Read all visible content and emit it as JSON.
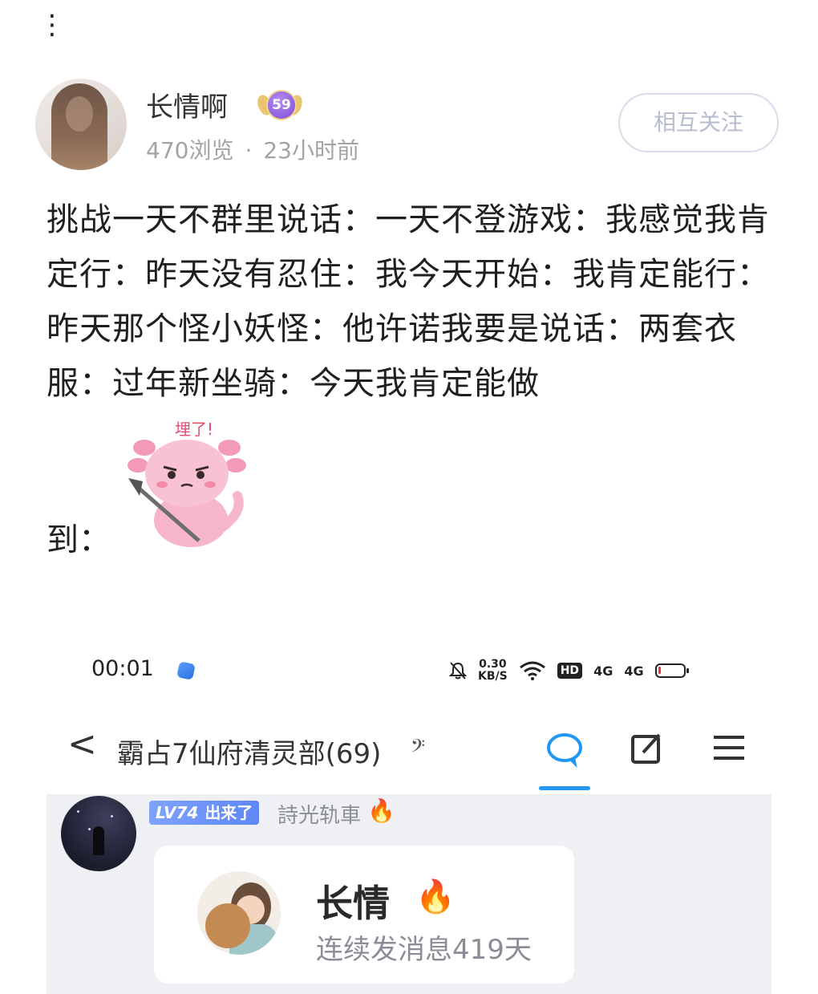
{
  "post": {
    "menu_glyph": "⋮",
    "author_name": "长情啊",
    "level": "59",
    "views": "470浏览",
    "separator": "·",
    "time_ago": "23小时前",
    "follow_label": "相互关注",
    "body_text": "挑战一天不群里说话：一天不登游戏：我感觉我肯定行：昨天没有忍住：我今天开始：我肯定能行：昨天那个怪小妖怪：他许诺我要是说话：两套衣服：过年新坐骑：今天我肯定能做",
    "body_tail": "到：",
    "sticker_text": "埋了!"
  },
  "embedded_screenshot": {
    "status_bar": {
      "time": "00:01",
      "net_speed_value": "0.30",
      "net_speed_unit": "KB/S",
      "hd_label": "HD",
      "signal_1": "4G",
      "signal_2": "4G",
      "battery_level": 0.05,
      "battery_color": "#e53935"
    },
    "nav": {
      "back_glyph": "<",
      "group_title": "霸占7仙府清灵部(69)",
      "ear_glyph": "𝄢",
      "icons": [
        "chat-bubble-icon",
        "edit-icon",
        "menu-icon"
      ],
      "accent_color": "#2196f3"
    },
    "message": {
      "badge_level": "LV74",
      "badge_title": "出来了",
      "sender_name": "詩光轨車",
      "fire_glyph": "🔥",
      "card": {
        "name": "长情",
        "fire_glyph": "🔥",
        "subtitle": "连续发消息419天"
      }
    }
  }
}
